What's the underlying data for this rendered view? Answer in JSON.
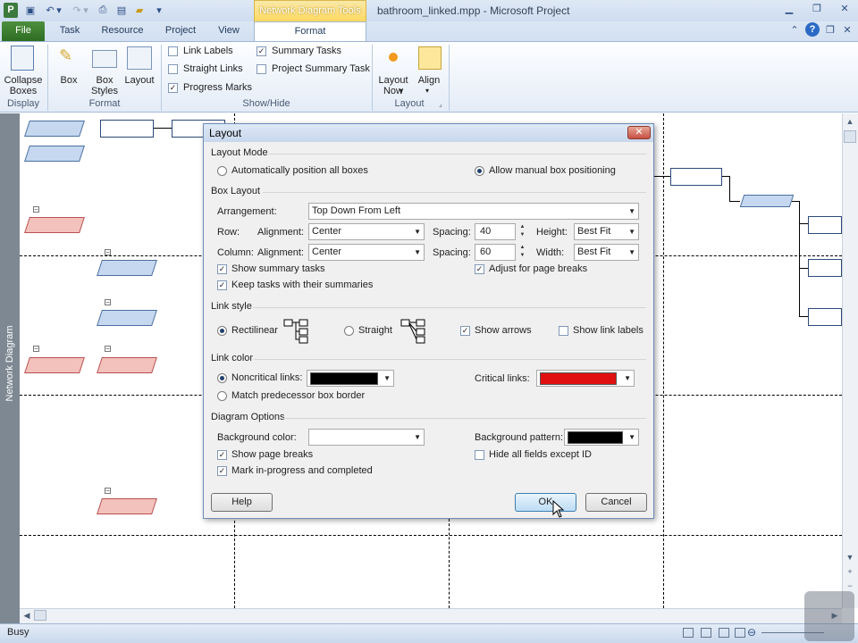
{
  "window": {
    "title": "bathroom_linked.mpp - Microsoft Project",
    "context_tab_group": "Network Diagram Tools",
    "app_icon": "P"
  },
  "quick_access": [
    "save-icon",
    "undo-icon",
    "redo-icon",
    "print-preview-icon",
    "open-icon",
    "customize-icon"
  ],
  "tabs": [
    {
      "label": "File"
    },
    {
      "label": "Task"
    },
    {
      "label": "Resource"
    },
    {
      "label": "Project"
    },
    {
      "label": "View"
    },
    {
      "label": "Format"
    }
  ],
  "ribbon": {
    "display": {
      "collapse_boxes": "Collapse Boxes",
      "group": "Display"
    },
    "format": {
      "box": "Box",
      "box_styles": "Box Styles",
      "layout": "Layout",
      "group": "Format"
    },
    "show_hide": {
      "link_labels": "Link Labels",
      "straight_links": "Straight Links",
      "progress_marks": "Progress Marks",
      "summary_tasks": "Summary Tasks",
      "project_summary_task": "Project Summary Task",
      "group": "Show/Hide",
      "checked": {
        "link_labels": false,
        "straight_links": false,
        "progress_marks": true,
        "summary_tasks": true,
        "project_summary_task": false
      }
    },
    "layout_group": {
      "layout_now": "Layout Now",
      "align": "Align",
      "group": "Layout"
    }
  },
  "sidebar": {
    "label": "Network Diagram"
  },
  "status": {
    "text": "Busy"
  },
  "dialog": {
    "title": "Layout",
    "layout_mode": {
      "heading": "Layout Mode",
      "auto": "Automatically position all boxes",
      "manual": "Allow manual box positioning",
      "selected": "manual"
    },
    "box_layout": {
      "heading": "Box Layout",
      "arrangement_label": "Arrangement:",
      "arrangement": "Top Down From Left",
      "row_label": "Row:",
      "column_label": "Column:",
      "alignment_label": "Alignment:",
      "row_alignment": "Center",
      "column_alignment": "Center",
      "spacing_label": "Spacing:",
      "row_spacing": "40",
      "column_spacing": "60",
      "height_label": "Height:",
      "height": "Best Fit",
      "width_label": "Width:",
      "width": "Best Fit",
      "show_summary": "Show summary tasks",
      "keep_with_summaries": "Keep tasks with their summaries",
      "adjust_page_breaks": "Adjust for page breaks"
    },
    "link_style": {
      "heading": "Link style",
      "rectilinear": "Rectilinear",
      "straight": "Straight",
      "selected": "rectilinear",
      "show_arrows": "Show arrows",
      "show_link_labels": "Show link labels"
    },
    "link_color": {
      "heading": "Link color",
      "noncritical_label": "Noncritical links:",
      "noncritical_color": "#000000",
      "critical_label": "Critical links:",
      "critical_color": "#e01010",
      "match_border": "Match predecessor box border",
      "selected": "noncritical"
    },
    "diagram_options": {
      "heading": "Diagram Options",
      "bg_color_label": "Background color:",
      "bg_color": "#ffffff",
      "bg_pattern_label": "Background pattern:",
      "bg_pattern_color": "#000000",
      "show_page_breaks": "Show page breaks",
      "mark_in_progress": "Mark in-progress and completed",
      "hide_all_fields": "Hide all fields except ID"
    },
    "buttons": {
      "help": "Help",
      "ok": "OK",
      "cancel": "Cancel"
    }
  }
}
